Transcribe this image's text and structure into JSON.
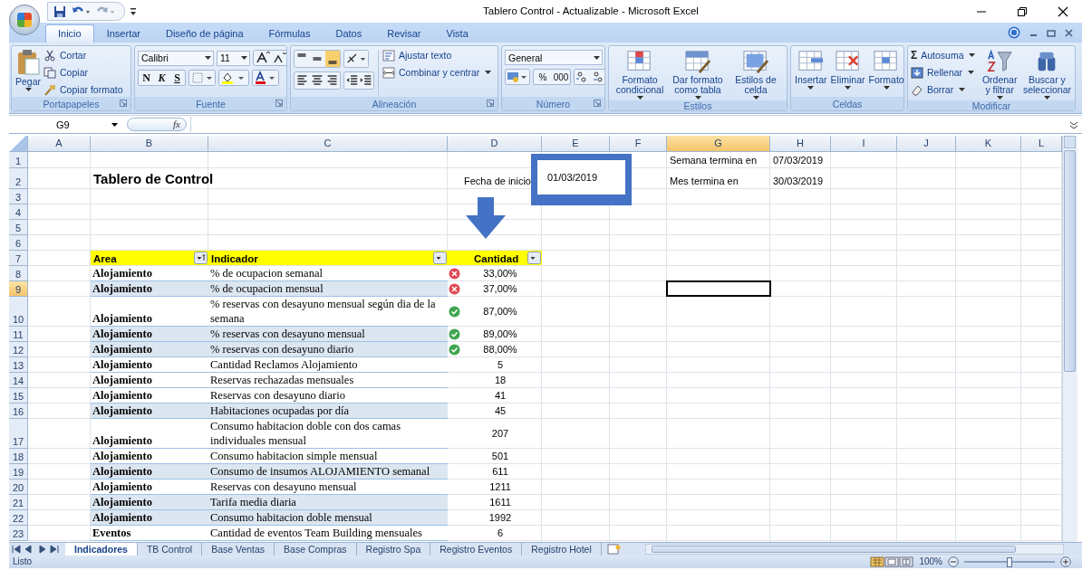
{
  "window": {
    "title": "Tablero Control - Actualizable - Microsoft Excel"
  },
  "tabs": [
    {
      "label": "Inicio",
      "selected": true
    },
    {
      "label": "Insertar",
      "selected": false
    },
    {
      "label": "Diseño de página",
      "selected": false
    },
    {
      "label": "Fórmulas",
      "selected": false
    },
    {
      "label": "Datos",
      "selected": false
    },
    {
      "label": "Revisar",
      "selected": false
    },
    {
      "label": "Vista",
      "selected": false
    }
  ],
  "ribbon": [
    {
      "kind": "clipboard",
      "label": "Portapapeles",
      "large": [
        "Pegar"
      ],
      "small": [
        "Cortar",
        "Copiar",
        "Copiar formato"
      ]
    },
    {
      "kind": "font",
      "label": "Fuente",
      "font": "Calibri",
      "size": "11",
      "styles": [
        "N",
        "K",
        "S"
      ]
    },
    {
      "kind": "alignment",
      "label": "Alineación",
      "small": [
        "Ajustar texto",
        "Combinar y centrar"
      ]
    },
    {
      "kind": "number",
      "label": "Número",
      "format": "General",
      "styles": [
        "%",
        "000"
      ]
    },
    {
      "kind": "gallery",
      "label": "Estilos",
      "large": [
        "Formato condicional",
        "Dar formato como tabla",
        "Estilos de celda"
      ]
    },
    {
      "kind": "gallery",
      "label": "Celdas",
      "large": [
        "Insertar",
        "Eliminar",
        "Formato"
      ]
    },
    {
      "kind": "editing",
      "label": "Modificar",
      "sum_symbol": "Σ",
      "small": [
        "Autosuma",
        "Rellenar",
        "Borrar"
      ],
      "large": [
        "Ordenar y filtrar",
        "Buscar y seleccionar"
      ]
    }
  ],
  "formula_bar": {
    "name_box": "G9",
    "function_label": "fx"
  },
  "sheet": {
    "columns": [
      {
        "letter": "A",
        "selected": false
      },
      {
        "letter": "B",
        "selected": false
      },
      {
        "letter": "C",
        "selected": false
      },
      {
        "letter": "D",
        "selected": false
      },
      {
        "letter": "E",
        "selected": false
      },
      {
        "letter": "F",
        "selected": false
      },
      {
        "letter": "G",
        "selected": true
      },
      {
        "letter": "H",
        "selected": false
      },
      {
        "letter": "I",
        "selected": false
      },
      {
        "letter": "J",
        "selected": false
      },
      {
        "letter": "K",
        "selected": false
      },
      {
        "letter": "L",
        "selected": false
      }
    ],
    "start_date": "01/03/2019",
    "rows": [
      {
        "kind": "info",
        "number": "1",
        "selected": false,
        "label": "Semana termina en",
        "value": "07/03/2019"
      },
      {
        "kind": "title",
        "number": "2",
        "selected": false,
        "title": "Tablero de Control",
        "start_label": "Fecha de inicio",
        "label": "Mes termina en",
        "value": "30/03/2019"
      },
      {
        "kind": "blank",
        "number": "3",
        "selected": false
      },
      {
        "kind": "blank",
        "number": "4",
        "selected": false
      },
      {
        "kind": "blank",
        "number": "5",
        "selected": false
      },
      {
        "kind": "blank",
        "number": "6",
        "selected": false
      },
      {
        "kind": "header",
        "number": "7",
        "selected": false,
        "headers": [
          "Area",
          "Indicador",
          "Cantidad"
        ]
      },
      {
        "kind": "data",
        "number": "8",
        "selected": false,
        "highlighted": false,
        "area": "Alojamiento",
        "indicator": "% de ocupacion semanal",
        "on_target": false,
        "amount": "33,00%"
      },
      {
        "kind": "data",
        "number": "9",
        "selected": true,
        "highlighted": true,
        "area": "Alojamiento",
        "indicator": "% de ocupacion mensual",
        "on_target": false,
        "amount": "37,00%"
      },
      {
        "kind": "data",
        "number": "10",
        "selected": false,
        "highlighted": false,
        "area": "Alojamiento",
        "indicator": "% reservas con desayuno mensual según dia de la semana",
        "on_target": true,
        "amount": "87,00%"
      },
      {
        "kind": "data",
        "number": "11",
        "selected": false,
        "highlighted": true,
        "area": "Alojamiento",
        "indicator": "% reservas con desayuno mensual",
        "on_target": true,
        "amount": "89,00%"
      },
      {
        "kind": "data",
        "number": "12",
        "selected": false,
        "highlighted": true,
        "area": "Alojamiento",
        "indicator": "% reservas con desayuno diario",
        "on_target": true,
        "amount": "88,00%"
      },
      {
        "kind": "data",
        "number": "13",
        "selected": false,
        "highlighted": false,
        "area": "Alojamiento",
        "indicator": "Cantidad Reclamos Alojamiento",
        "amount": "5"
      },
      {
        "kind": "data",
        "number": "14",
        "selected": false,
        "highlighted": false,
        "area": "Alojamiento",
        "indicator": "Reservas rechazadas mensuales",
        "amount": "18"
      },
      {
        "kind": "data",
        "number": "15",
        "selected": false,
        "highlighted": false,
        "area": "Alojamiento",
        "indicator": "Reservas con desayuno diario",
        "amount": "41"
      },
      {
        "kind": "data",
        "number": "16",
        "selected": false,
        "highlighted": true,
        "area": "Alojamiento",
        "indicator": "Habitaciones ocupadas por día",
        "amount": "45"
      },
      {
        "kind": "data",
        "number": "17",
        "selected": false,
        "highlighted": false,
        "area": "Alojamiento",
        "indicator": "Consumo habitacion doble con dos camas individuales mensual",
        "amount": "207"
      },
      {
        "kind": "data",
        "number": "18",
        "selected": false,
        "highlighted": false,
        "area": "Alojamiento",
        "indicator": "Consumo habitacion simple mensual",
        "amount": "501"
      },
      {
        "kind": "data",
        "number": "19",
        "selected": false,
        "highlighted": true,
        "area": "Alojamiento",
        "indicator": "Consumo de insumos ALOJAMIENTO semanal",
        "amount": "611"
      },
      {
        "kind": "data",
        "number": "20",
        "selected": false,
        "highlighted": false,
        "area": "Alojamiento",
        "indicator": "Reservas con desayuno mensual",
        "amount": "1211"
      },
      {
        "kind": "data",
        "number": "21",
        "selected": false,
        "highlighted": true,
        "area": "Alojamiento",
        "indicator": "Tarifa media diaria",
        "amount": "1611"
      },
      {
        "kind": "data",
        "number": "22",
        "selected": false,
        "highlighted": true,
        "area": "Alojamiento",
        "indicator": "Consumo habitacion doble mensual",
        "amount": "1992"
      },
      {
        "kind": "data",
        "number": "23",
        "selected": false,
        "highlighted": false,
        "area": "Eventos",
        "indicator": "Cantidad de eventos Team Building mensuales",
        "amount": "6"
      }
    ]
  },
  "sheet_tabs": [
    {
      "label": "Indicadores",
      "selected": true
    },
    {
      "label": "TB Control",
      "selected": false
    },
    {
      "label": "Base Ventas",
      "selected": false
    },
    {
      "label": "Base Compras",
      "selected": false
    },
    {
      "label": "Registro Spa",
      "selected": false
    },
    {
      "label": "Registro Eventos",
      "selected": false
    },
    {
      "label": "Registro Hotel",
      "selected": false
    }
  ],
  "status_bar": {
    "text": "Listo",
    "zoom": {
      "label": "100%",
      "level": 0.5
    }
  }
}
